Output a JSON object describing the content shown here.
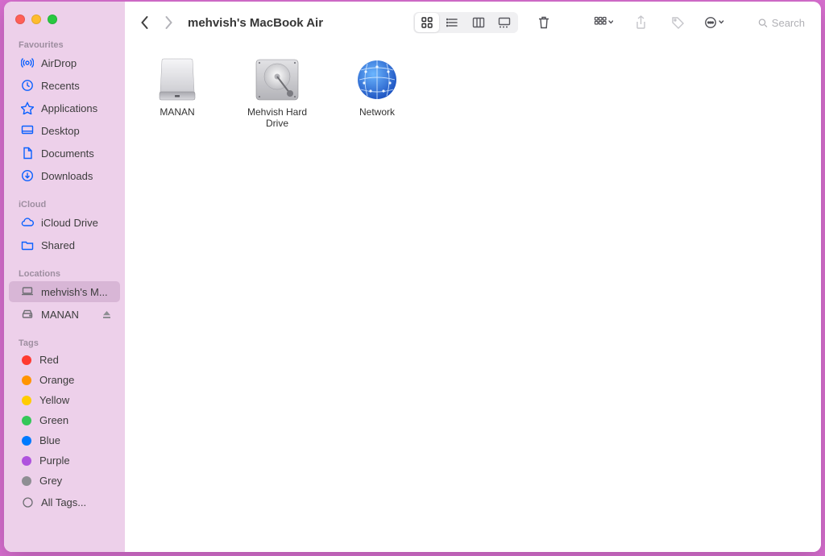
{
  "window_title": "mehvish's MacBook Air",
  "search_placeholder": "Search",
  "sections": {
    "favourites": "Favourites",
    "icloud": "iCloud",
    "locations": "Locations",
    "tags": "Tags"
  },
  "sidebar": {
    "favourites": [
      {
        "label": "AirDrop",
        "icon": "airdrop-icon"
      },
      {
        "label": "Recents",
        "icon": "clock-icon"
      },
      {
        "label": "Applications",
        "icon": "apps-icon"
      },
      {
        "label": "Desktop",
        "icon": "desktop-icon"
      },
      {
        "label": "Documents",
        "icon": "documents-icon"
      },
      {
        "label": "Downloads",
        "icon": "downloads-icon"
      }
    ],
    "icloud": [
      {
        "label": "iCloud Drive",
        "icon": "icloud-icon"
      },
      {
        "label": "Shared",
        "icon": "shared-folder-icon"
      }
    ],
    "locations": [
      {
        "label": "mehvish's M...",
        "icon": "laptop-icon",
        "selected": true
      },
      {
        "label": "MANAN",
        "icon": "disk-icon",
        "ejectable": true
      }
    ],
    "tags": [
      {
        "label": "Red",
        "color": "#ff3b30"
      },
      {
        "label": "Orange",
        "color": "#ff9500"
      },
      {
        "label": "Yellow",
        "color": "#ffcc00"
      },
      {
        "label": "Green",
        "color": "#34c759"
      },
      {
        "label": "Blue",
        "color": "#007aff"
      },
      {
        "label": "Purple",
        "color": "#af52de"
      },
      {
        "label": "Grey",
        "color": "#8e8e93"
      }
    ],
    "all_tags_label": "All Tags..."
  },
  "items": [
    {
      "label": "MANAN",
      "kind": "external-drive"
    },
    {
      "label": "Mehvish Hard Drive",
      "kind": "internal-drive"
    },
    {
      "label": "Network",
      "kind": "network"
    }
  ],
  "toolbar_view": "icon"
}
